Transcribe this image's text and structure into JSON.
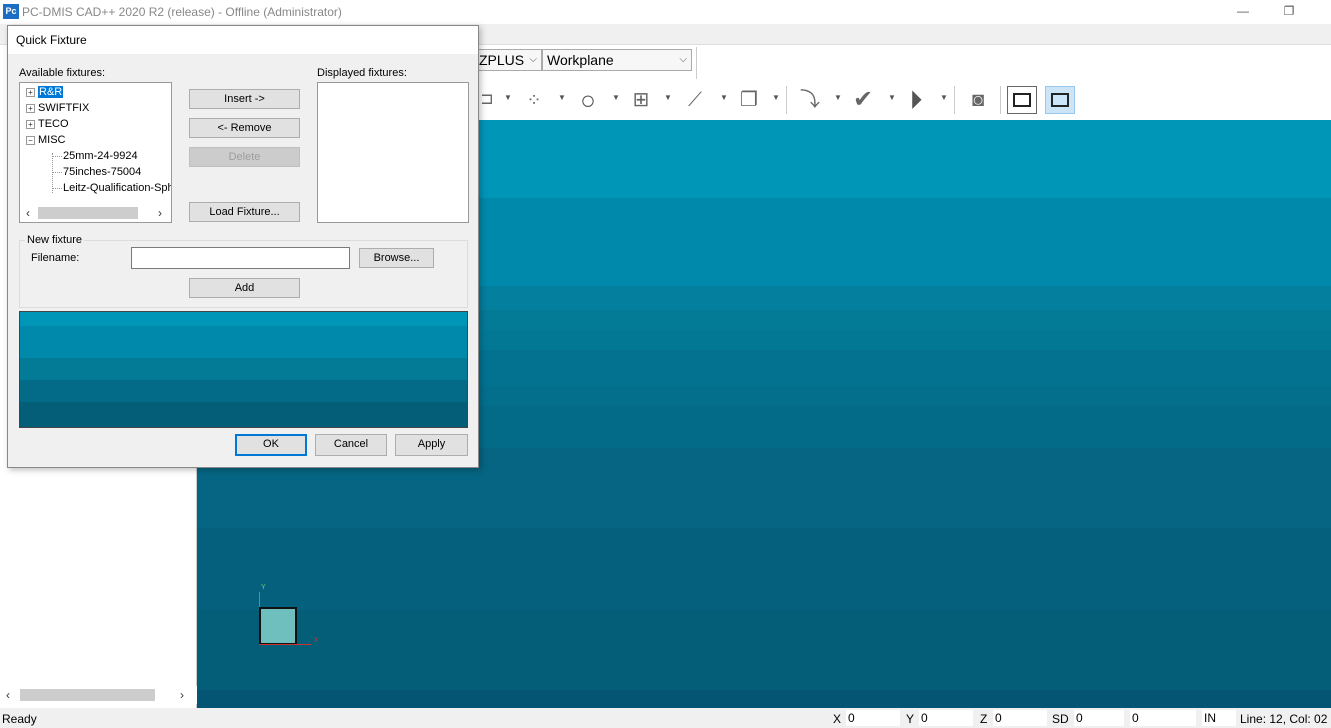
{
  "window": {
    "title": "PC-DMIS CAD++ 2020 R2 (release) - Offline (Administrator)",
    "logo": "Pc",
    "minimize": "—",
    "restore": "❐"
  },
  "toolbar": {
    "view_select": "ZPLUS",
    "workplane_select": "Workplane"
  },
  "dialog": {
    "title": "Quick Fixture",
    "available_label": "Available fixtures:",
    "displayed_label": "Displayed fixtures:",
    "tree": [
      {
        "label": "R&R",
        "expander": "+",
        "selected": true
      },
      {
        "label": "SWIFTFIX",
        "expander": "+"
      },
      {
        "label": "TECO",
        "expander": "+"
      },
      {
        "label": "MISC",
        "expander": "−"
      },
      {
        "label": "25mm-24-9924",
        "child": true
      },
      {
        "label": "75inches-75004",
        "child": true
      },
      {
        "label": "Leitz-Qualification-Sph",
        "child": true
      }
    ],
    "insert_button": "Insert ->",
    "remove_button": "<- Remove",
    "delete_button": "Delete",
    "load_button": "Load Fixture...",
    "new_fixture_group": "New fixture",
    "filename_label": "Filename:",
    "filename_value": "",
    "browse_button": "Browse...",
    "add_button": "Add",
    "ok_button": "OK",
    "cancel_button": "Cancel",
    "apply_button": "Apply"
  },
  "status": {
    "ready": "Ready",
    "x_label": "X",
    "x_value": "0",
    "y_label": "Y",
    "y_value": "0",
    "z_label": "Z",
    "z_value": "0",
    "sd_label": "SD",
    "sd_value": "0",
    "extra_value": "0",
    "units": "IN",
    "line_col": "Line: 12, Col: 02"
  },
  "viewport": {
    "axis_y": "Y",
    "axis_x": "X"
  },
  "colors": {
    "selection": "#0078d7",
    "viewport_top": "#0096b8",
    "viewport_bottom": "#045e78"
  }
}
